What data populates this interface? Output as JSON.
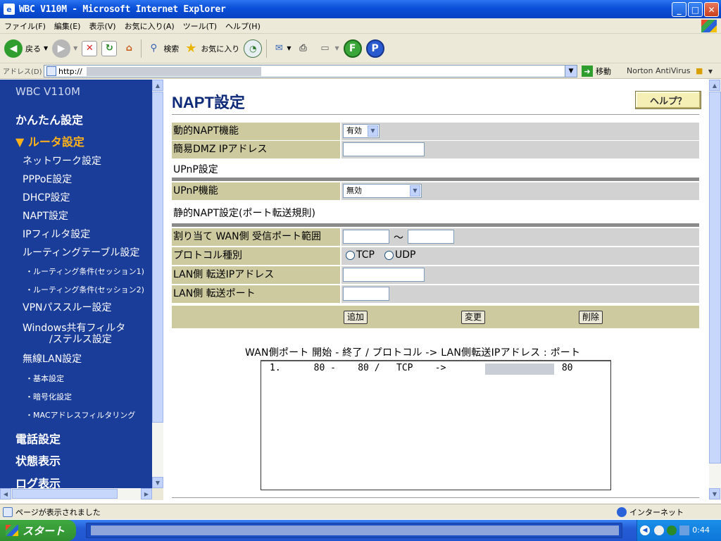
{
  "window": {
    "title": "WBC V110M - Microsoft Internet Explorer",
    "controls": {
      "minimize": "_",
      "maximize": "□",
      "close": "✕"
    }
  },
  "menubar": [
    "ファイル(F)",
    "編集(E)",
    "表示(V)",
    "お気に入り(A)",
    "ツール(T)",
    "ヘルプ(H)"
  ],
  "toolbar": {
    "back_label": "戻る",
    "search_label": "検索",
    "favorites_label": "お気に入り",
    "icons": [
      "back-icon",
      "forward-icon",
      "stop-icon",
      "refresh-icon",
      "home-icon",
      "search-icon",
      "favorites-icon",
      "history-icon",
      "mail-icon",
      "print-icon",
      "edit-icon",
      "f-icon",
      "p-icon"
    ],
    "f_glyph": "F",
    "p_glyph": "P"
  },
  "addressbar": {
    "label": "アドレス(D)",
    "url": "http://",
    "go_label": "移動",
    "norton_label": "Norton AntiVirus"
  },
  "sidebar": {
    "brand": "WBC V110M",
    "items": [
      {
        "label": "かんたん設定"
      },
      {
        "label": "▼ ルータ設定"
      },
      {
        "label": "ネットワーク設定"
      },
      {
        "label": "PPPoE設定"
      },
      {
        "label": "DHCP設定"
      },
      {
        "label": "NAPT設定"
      },
      {
        "label": "IPフィルタ設定"
      },
      {
        "label": "ルーティングテーブル設定"
      },
      {
        "label": "・ルーティング条件(セッション1)"
      },
      {
        "label": "・ルーティング条件(セッション2)"
      },
      {
        "label": "VPNパススルー設定"
      },
      {
        "label": "Windows共有フィルタ"
      },
      {
        "label": "/ステルス設定"
      },
      {
        "label": "無線LAN設定"
      },
      {
        "label": "・基本設定"
      },
      {
        "label": "・暗号化設定"
      },
      {
        "label": "・MACアドレスフィルタリング"
      },
      {
        "label": "電話設定"
      },
      {
        "label": "状態表示"
      },
      {
        "label": "ログ表示"
      }
    ]
  },
  "main": {
    "title": "NAPT設定",
    "help_button": "ヘルプ？",
    "dynamic_napt_label": "動的NAPT機能",
    "dynamic_napt_value": "有効",
    "dmz_label": "簡易DMZ IPアドレス",
    "dmz_value": "",
    "upnp_section": "UPnP設定",
    "upnp_label": "UPnP機能",
    "upnp_value": "無効",
    "static_section": "静的NAPT設定(ポート転送規則)",
    "wan_port_label": "割り当て WAN側 受信ポート範囲",
    "range_sep": "～",
    "wan_port_from": "",
    "wan_port_to": "",
    "protocol_label": "プロトコル種別",
    "protocol_tcp": "TCP",
    "protocol_udp": "UDP",
    "lan_ip_label": "LAN側 転送IPアドレス",
    "lan_ip_value": "",
    "lan_port_label": "LAN側 転送ポート",
    "lan_port_value": "",
    "add_button": "追加",
    "change_button": "変更",
    "delete_button": "削除",
    "list_header": "WAN側ポート 開始 - 終了  / プロトコル  ->   LAN側転送IPアドレス  :  ポート",
    "list_rows": [
      "1.      80 -    80 /   TCP    ->                :    80"
    ]
  },
  "statusbar": {
    "message": "ページが表示されました",
    "zone": "インターネット"
  },
  "taskbar": {
    "start_label": "スタート",
    "clock": "0:44"
  }
}
